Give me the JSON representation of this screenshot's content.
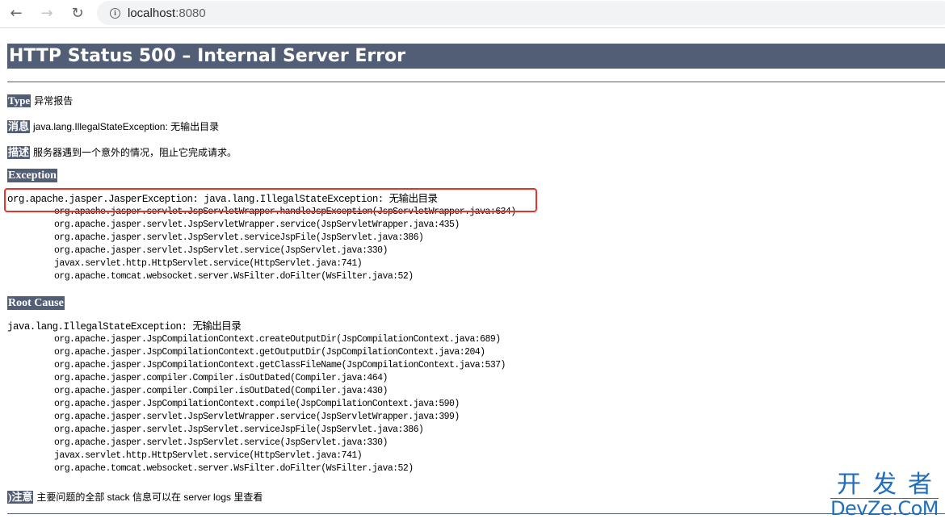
{
  "browser": {
    "url_host": "localhost",
    "url_port": ":8080",
    "back_icon": "arrow-left-icon",
    "forward_icon": "arrow-right-icon",
    "reload_icon": "reload-icon",
    "info_icon": "info-icon"
  },
  "page": {
    "title": "HTTP Status 500 – Internal Server Error",
    "type": {
      "label": "Type",
      "value": "异常报告"
    },
    "message": {
      "label": "消息",
      "value": "java.lang.IllegalStateException: 无输出目录"
    },
    "description": {
      "label": "描述",
      "value": "服务器遇到一个意外的情况，阻止它完成请求。"
    },
    "exception": {
      "label": "Exception",
      "head": "org.apache.jasper.JasperException: java.lang.IllegalStateException: 无输出目录",
      "frames": [
        "org.apache.jasper.servlet.JspServletWrapper.handleJspException(JspServletWrapper.java:634)",
        "org.apache.jasper.servlet.JspServletWrapper.service(JspServletWrapper.java:435)",
        "org.apache.jasper.servlet.JspServlet.serviceJspFile(JspServlet.java:386)",
        "org.apache.jasper.servlet.JspServlet.service(JspServlet.java:330)",
        "javax.servlet.http.HttpServlet.service(HttpServlet.java:741)",
        "org.apache.tomcat.websocket.server.WsFilter.doFilter(WsFilter.java:52)"
      ]
    },
    "root_cause": {
      "label": "Root Cause",
      "head": "java.lang.IllegalStateException: 无输出目录",
      "frames": [
        "org.apache.jasper.JspCompilationContext.createOutputDir(JspCompilationContext.java:689)",
        "org.apache.jasper.JspCompilationContext.getOutputDir(JspCompilationContext.java:204)",
        "org.apache.jasper.JspCompilationContext.getClassFileName(JspCompilationContext.java:537)",
        "org.apache.jasper.compiler.Compiler.isOutDated(Compiler.java:464)",
        "org.apache.jasper.compiler.Compiler.isOutDated(Compiler.java:430)",
        "org.apache.jasper.JspCompilationContext.compile(JspCompilationContext.java:590)",
        "org.apache.jasper.servlet.JspServletWrapper.service(JspServletWrapper.java:399)",
        "org.apache.jasper.servlet.JspServlet.serviceJspFile(JspServlet.java:386)",
        "org.apache.jasper.servlet.JspServlet.service(JspServlet.java:330)",
        "javax.servlet.http.HttpServlet.service(HttpServlet.java:741)",
        "org.apache.tomcat.websocket.server.WsFilter.doFilter(WsFilter.java:52)"
      ]
    },
    "note": {
      "label": ")注意",
      "value": "主要问题的全部 stack 信息可以在 server logs 里查看"
    }
  },
  "watermark": {
    "cn": "开发者",
    "en": "DevZe.CoM"
  },
  "colors": {
    "header_bg": "#525d76",
    "highlight": "#e8332a",
    "watermark": "#1f6fbd"
  }
}
